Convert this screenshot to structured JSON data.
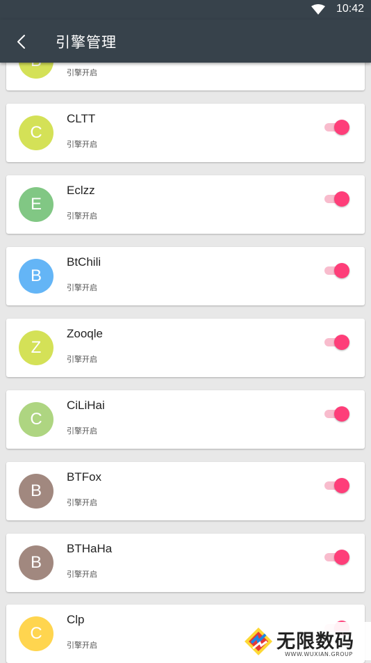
{
  "status_bar": {
    "time": "10:42"
  },
  "header": {
    "title": "引擎管理"
  },
  "engines": [
    {
      "letter": "B",
      "name": "",
      "status": "引擎开启",
      "color": "#d4e157",
      "enabled": true
    },
    {
      "letter": "C",
      "name": "CLTT",
      "status": "引擎开启",
      "color": "#d4e157",
      "enabled": true
    },
    {
      "letter": "E",
      "name": "Eclzz",
      "status": "引擎开启",
      "color": "#81c784",
      "enabled": true
    },
    {
      "letter": "B",
      "name": "BtChili",
      "status": "引擎开启",
      "color": "#64b5f6",
      "enabled": true
    },
    {
      "letter": "Z",
      "name": "Zooqle",
      "status": "引擎开启",
      "color": "#d4e157",
      "enabled": true
    },
    {
      "letter": "C",
      "name": "CiLiHai",
      "status": "引擎开启",
      "color": "#aed581",
      "enabled": true
    },
    {
      "letter": "B",
      "name": "BTFox",
      "status": "引擎开启",
      "color": "#a1887f",
      "enabled": true
    },
    {
      "letter": "B",
      "name": "BTHaHa",
      "status": "引擎开启",
      "color": "#a1887f",
      "enabled": true
    },
    {
      "letter": "C",
      "name": "Clp",
      "status": "引擎开启",
      "color": "#ffd54f",
      "enabled": true
    }
  ],
  "watermark": {
    "title": "无限数码",
    "url": "WWW.WUXIAN.GROUP"
  },
  "colors": {
    "bar": "#37424b",
    "toggle_thumb": "#fe3e79",
    "toggle_track": "#f8bccd"
  }
}
